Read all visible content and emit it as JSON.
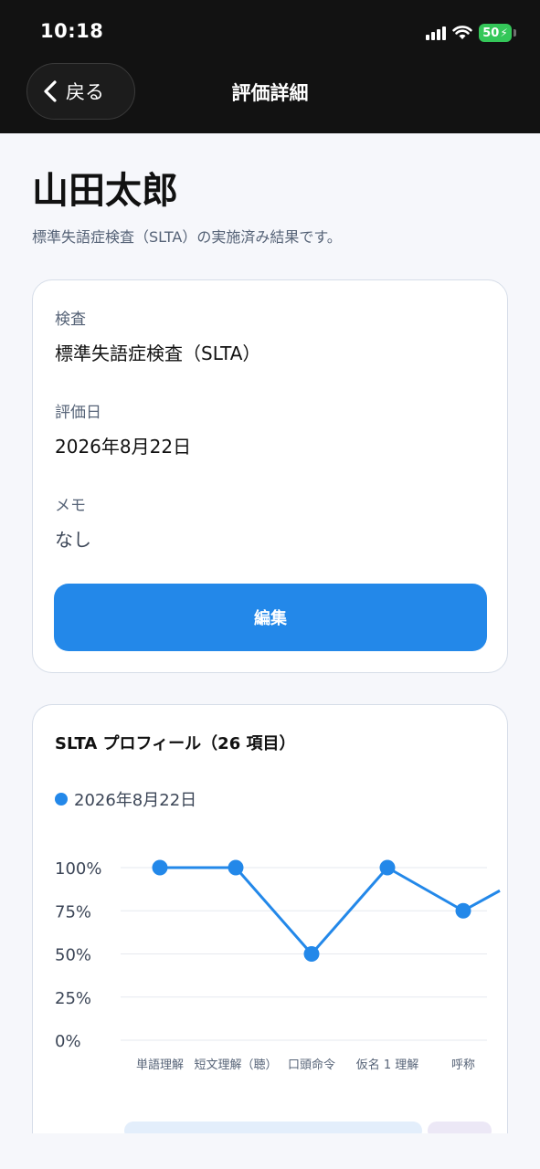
{
  "status_bar": {
    "time": "10:18",
    "battery": "50"
  },
  "nav": {
    "back_label": "戻る",
    "title": "評価詳細"
  },
  "patient": {
    "name": "山田太郎",
    "subtitle": "標準失語症検査（SLTA）の実施済み結果です。"
  },
  "info": {
    "test_label": "検査",
    "test_value": "標準失語症検査（SLTA）",
    "date_label": "評価日",
    "date_value": "2026年8月22日",
    "memo_label": "メモ",
    "memo_value": "なし",
    "edit_label": "編集"
  },
  "colors": {
    "accent": "#2388e9",
    "header_bg": "#121212",
    "battery": "#34c759"
  },
  "chart_data": {
    "type": "line",
    "title": "SLTA プロフィール（26 項目）",
    "categories": [
      "単語理解",
      "短文理解（聴）",
      "口頭命令",
      "仮名 1 理解",
      "呼称"
    ],
    "series": [
      {
        "name": "2026年8月22日",
        "values": [
          100,
          100,
          50,
          100,
          75
        ],
        "color": "#2388e9"
      }
    ],
    "y_ticks": [
      "100%",
      "75%",
      "50%",
      "25%",
      "0%"
    ],
    "ylim": [
      0,
      100
    ],
    "grid": true,
    "legend": "top-left"
  }
}
